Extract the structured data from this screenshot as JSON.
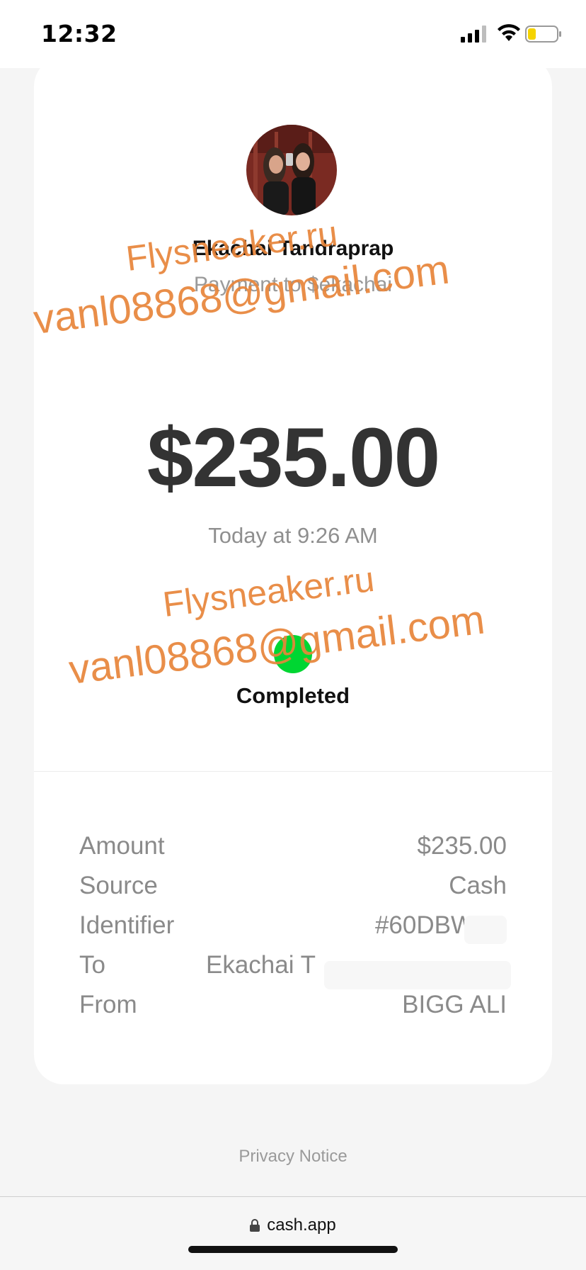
{
  "status_bar": {
    "time": "12:32"
  },
  "payment": {
    "recipient_name": "Ekachai Tandraprap",
    "subtitle": "Payment to $ekachai",
    "amount": "$235.00",
    "timestamp": "Today at 9:26 AM",
    "status": "Completed",
    "status_color": "#00d632"
  },
  "details": [
    {
      "label": "Amount",
      "value": "$235.00"
    },
    {
      "label": "Source",
      "value": "Cash"
    },
    {
      "label": "Identifier",
      "value": "#60DBW"
    },
    {
      "label": "To",
      "value": "Ekachai T"
    },
    {
      "label": "From",
      "value": "BIGG ALI"
    }
  ],
  "footer": {
    "privacy_notice": "Privacy Notice",
    "url": "cash.app"
  },
  "watermark": {
    "line1": "Flysneaker.ru",
    "line2": "vanl08868@gmail.com",
    "color": "#e8853a"
  }
}
